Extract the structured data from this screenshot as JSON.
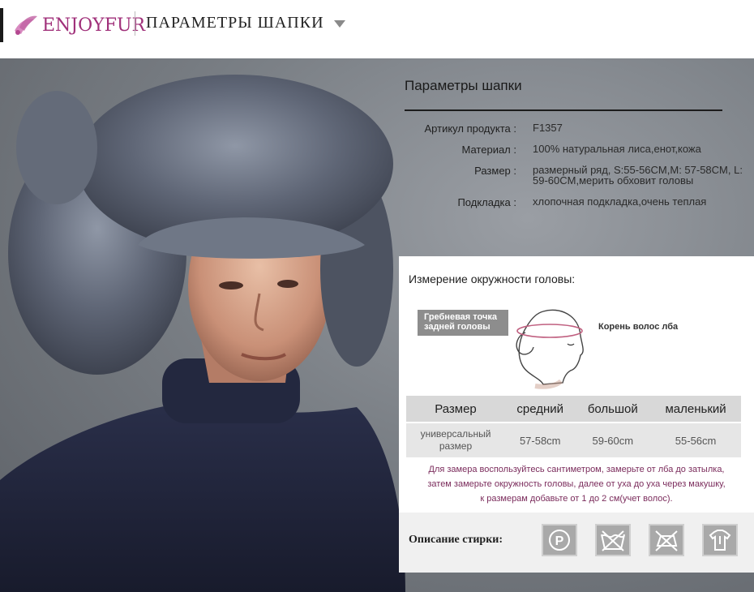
{
  "header": {
    "logo_text": "ENJOYFUR",
    "title": "ПАРАМЕТРЫ ШАПКИ"
  },
  "params": {
    "title": "Параметры шапки",
    "rows": [
      {
        "label": "Артикул продукта :",
        "value": "F1357"
      },
      {
        "label": "Материал :",
        "value": "100% натуральная лиса,енот,кожа"
      },
      {
        "label": "Размер :",
        "value": "размерный ряд, S:55-56CM,M: 57-58CM, L: 59-60CM,мерить обховит головы"
      },
      {
        "label": "Подкладка :",
        "value": "хлопочная подкладка,очень теплая"
      }
    ]
  },
  "measure": {
    "title": "Измерение окружности головы:",
    "tag_back": "Гребневая точка задней головы",
    "tag_front": "Корень волос лба",
    "table": {
      "headers": [
        "Размер",
        "средний",
        "большой",
        "маленький"
      ],
      "row": [
        "универсальный размер",
        "57-58cm",
        "59-60cm",
        "55-56cm"
      ]
    },
    "note_lines": [
      "Для замера воспользуйтесь сантиметром, замерьте от лба до затылка,",
      "затем замерьте окружность головы, далее от уха до уха через макушку,",
      "к размерам добавьте от 1 до 2 см(учет волос)."
    ]
  },
  "wash": {
    "label": "Описание стирки:",
    "icon_p_text": "P",
    "icons": [
      "dry-clean-p-icon",
      "no-wash-icon",
      "no-iron-icon",
      "no-tumble-dry-icon"
    ]
  },
  "colors": {
    "brand": "#a0307a",
    "note": "#7b2c5c",
    "panel_bg": "#ffffff",
    "table_head": "#d8d8d8"
  }
}
